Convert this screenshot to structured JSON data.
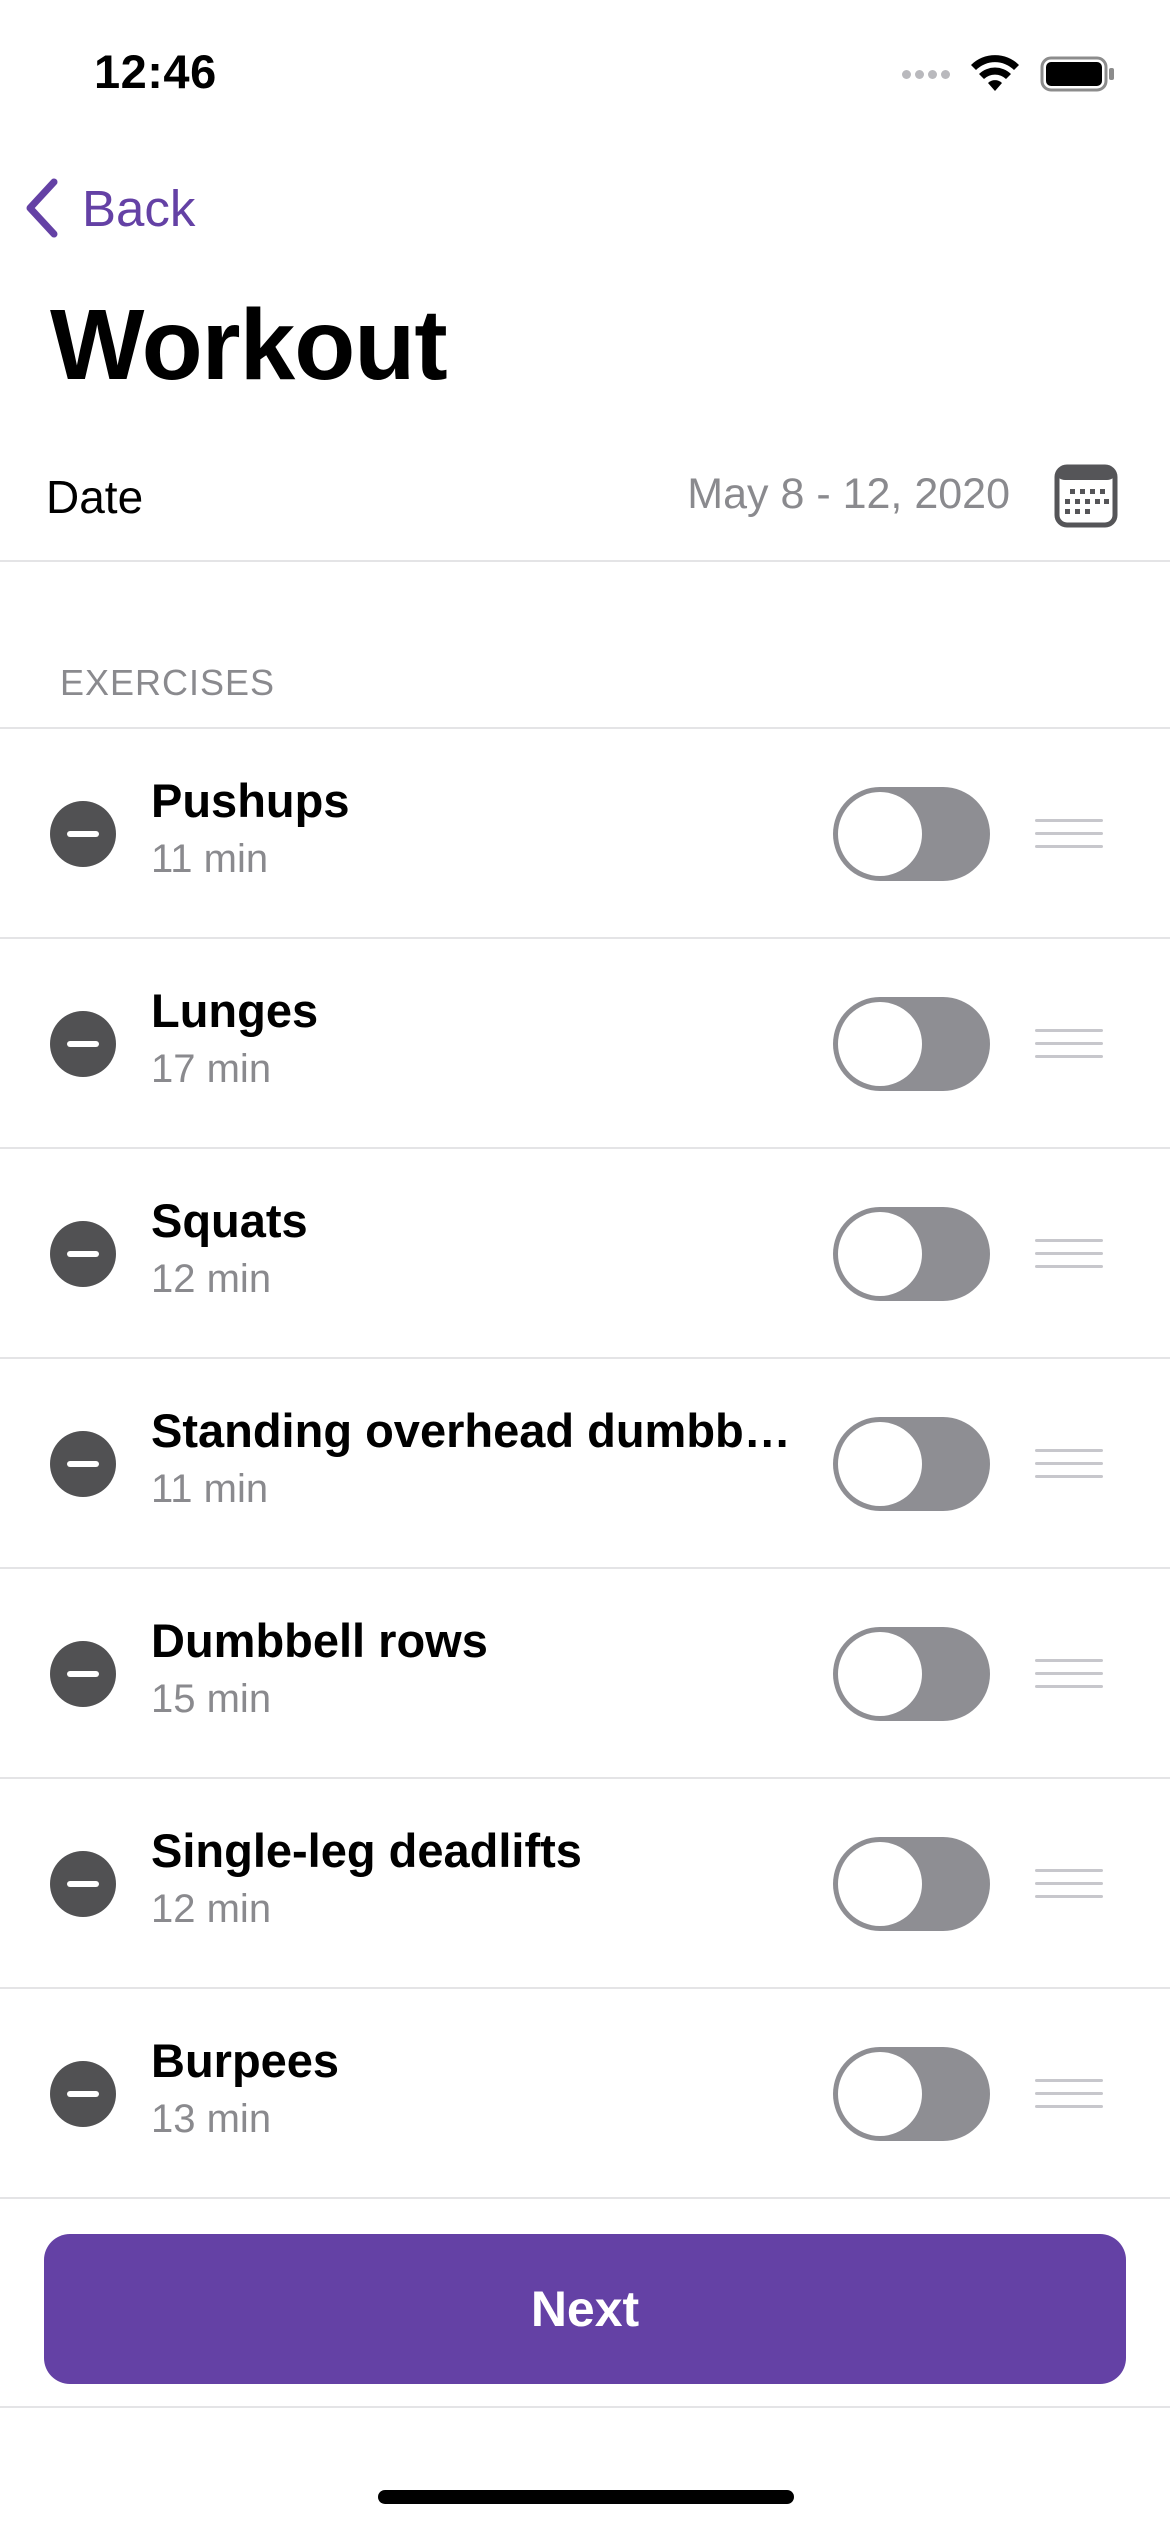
{
  "status_bar": {
    "time": "12:46",
    "icons": [
      "signal-icon",
      "wifi-icon",
      "battery-icon"
    ]
  },
  "nav": {
    "back_label": "Back",
    "back_icon": "chevron-left-icon"
  },
  "title": "Workout",
  "date_row": {
    "label": "Date",
    "value": "May 8 - 12, 2020",
    "icon": "calendar-icon"
  },
  "exercises_header": "EXERCISES",
  "exercises": [
    {
      "name": "Pushups",
      "duration": "11 min",
      "enabled": false
    },
    {
      "name": "Lunges",
      "duration": "17 min",
      "enabled": false
    },
    {
      "name": "Squats",
      "duration": "12 min",
      "enabled": false
    },
    {
      "name": "Standing overhead dumbb…",
      "duration": "11 min",
      "enabled": false
    },
    {
      "name": "Dumbbell rows",
      "duration": "15 min",
      "enabled": false
    },
    {
      "name": "Single-leg deadlifts",
      "duration": "12 min",
      "enabled": false
    },
    {
      "name": "Burpees",
      "duration": "13 min",
      "enabled": false
    }
  ],
  "next_label": "Next",
  "colors": {
    "accent": "#6441a5",
    "toggle_off": "#8e8e93",
    "secondary_text": "#8a8a8e"
  }
}
